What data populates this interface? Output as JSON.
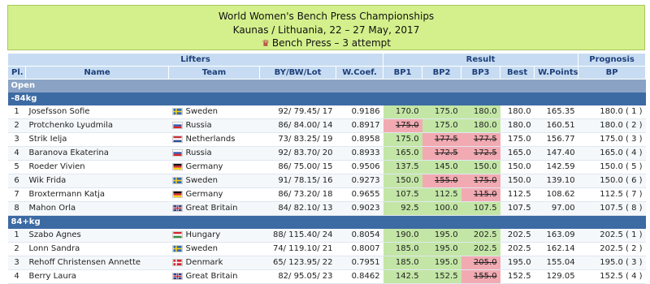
{
  "header": {
    "title": "World Women's Bench Press Championships",
    "location": "Kaunas / Lithuania, 22 – 27 May, 2017",
    "event": "Bench Press – 3 attempt"
  },
  "columns": {
    "group_lifters": "Lifters",
    "group_result": "Result",
    "group_prognosis": "Prognosis",
    "pl": "Pl.",
    "name": "Name",
    "team": "Team",
    "by": "BY/BW/Lot",
    "wcoef": "W.Coef.",
    "bp1": "BP1",
    "bp2": "BP2",
    "bp3": "BP3",
    "best": "Best",
    "wpoints": "W.Points",
    "bp": "BP"
  },
  "category_open": "Open",
  "classes": [
    {
      "label": "-84kg",
      "rows": [
        {
          "pl": "1",
          "name": "Josefsson Sofie",
          "team": "Sweden",
          "flag": "se",
          "by": "92/ 79.45/ 17",
          "wcoef": "0.9186",
          "bp1": "170.0",
          "bp1s": "good",
          "bp2": "175.0",
          "bp2s": "good",
          "bp3": "180.0",
          "bp3s": "good",
          "best": "180.0",
          "wpoints": "165.35",
          "bp": "180.0 ( 1 )"
        },
        {
          "pl": "2",
          "name": "Protchenko Lyudmila",
          "team": "Russia",
          "flag": "ru",
          "by": "86/ 84.00/ 14",
          "wcoef": "0.8917",
          "bp1": "175.0",
          "bp1s": "bad",
          "bp2": "175.0",
          "bp2s": "good",
          "bp3": "180.0",
          "bp3s": "good",
          "best": "180.0",
          "wpoints": "160.51",
          "bp": "180.0 ( 2 )"
        },
        {
          "pl": "3",
          "name": "Strik Ielja",
          "team": "Netherlands",
          "flag": "nl",
          "by": "73/ 83.25/ 19",
          "wcoef": "0.8958",
          "bp1": "175.0",
          "bp1s": "good",
          "bp2": "177.5",
          "bp2s": "bad",
          "bp3": "177.5",
          "bp3s": "bad",
          "best": "175.0",
          "wpoints": "156.77",
          "bp": "175.0 ( 3 )"
        },
        {
          "pl": "4",
          "name": "Baranova Ekaterina",
          "team": "Russia",
          "flag": "ru",
          "by": "92/ 83.70/ 20",
          "wcoef": "0.8933",
          "bp1": "165.0",
          "bp1s": "good",
          "bp2": "172.5",
          "bp2s": "bad",
          "bp3": "172.5",
          "bp3s": "bad",
          "best": "165.0",
          "wpoints": "147.40",
          "bp": "165.0 ( 4 )"
        },
        {
          "pl": "5",
          "name": "Roeder Vivien",
          "team": "Germany",
          "flag": "de",
          "by": "86/ 75.00/ 15",
          "wcoef": "0.9506",
          "bp1": "137.5",
          "bp1s": "good",
          "bp2": "145.0",
          "bp2s": "good",
          "bp3": "150.0",
          "bp3s": "good",
          "best": "150.0",
          "wpoints": "142.59",
          "bp": "150.0 ( 5 )"
        },
        {
          "pl": "6",
          "name": "Wik Frida",
          "team": "Sweden",
          "flag": "se",
          "by": "91/ 78.15/ 16",
          "wcoef": "0.9273",
          "bp1": "150.0",
          "bp1s": "good",
          "bp2": "155.0",
          "bp2s": "bad",
          "bp3": "175.0",
          "bp3s": "bad",
          "best": "150.0",
          "wpoints": "139.10",
          "bp": "150.0 ( 6 )"
        },
        {
          "pl": "7",
          "name": "Broxtermann Katja",
          "team": "Germany",
          "flag": "de",
          "by": "86/ 73.20/ 18",
          "wcoef": "0.9655",
          "bp1": "107.5",
          "bp1s": "good",
          "bp2": "112.5",
          "bp2s": "good",
          "bp3": "115.0",
          "bp3s": "bad",
          "best": "112.5",
          "wpoints": "108.62",
          "bp": "112.5 ( 7 )"
        },
        {
          "pl": "8",
          "name": "Mahon Orla",
          "team": "Great Britain",
          "flag": "gb",
          "by": "84/ 82.10/ 13",
          "wcoef": "0.9023",
          "bp1": "92.5",
          "bp1s": "good",
          "bp2": "100.0",
          "bp2s": "good",
          "bp3": "107.5",
          "bp3s": "good",
          "best": "107.5",
          "wpoints": "97.00",
          "bp": "107.5 ( 8 )"
        }
      ]
    },
    {
      "label": "84+kg",
      "rows": [
        {
          "pl": "1",
          "name": "Szabo Agnes",
          "team": "Hungary",
          "flag": "hu",
          "by": "88/ 115.40/ 24",
          "wcoef": "0.8054",
          "bp1": "190.0",
          "bp1s": "good",
          "bp2": "195.0",
          "bp2s": "good",
          "bp3": "202.5",
          "bp3s": "good",
          "best": "202.5",
          "wpoints": "163.09",
          "bp": "202.5 ( 1 )"
        },
        {
          "pl": "2",
          "name": "Lonn Sandra",
          "team": "Sweden",
          "flag": "se",
          "by": "74/ 119.10/ 21",
          "wcoef": "0.8007",
          "bp1": "185.0",
          "bp1s": "good",
          "bp2": "195.0",
          "bp2s": "good",
          "bp3": "202.5",
          "bp3s": "good",
          "best": "202.5",
          "wpoints": "162.14",
          "bp": "202.5 ( 2 )"
        },
        {
          "pl": "3",
          "name": "Rehoff Christensen Annette",
          "team": "Denmark",
          "flag": "dk",
          "by": "65/ 123.95/ 22",
          "wcoef": "0.7951",
          "bp1": "185.0",
          "bp1s": "good",
          "bp2": "195.0",
          "bp2s": "good",
          "bp3": "205.0",
          "bp3s": "bad",
          "best": "195.0",
          "wpoints": "155.04",
          "bp": "195.0 ( 3 )"
        },
        {
          "pl": "4",
          "name": "Berry Laura",
          "team": "Great Britain",
          "flag": "gb",
          "by": "82/ 95.05/ 23",
          "wcoef": "0.8462",
          "bp1": "142.5",
          "bp1s": "good",
          "bp2": "152.5",
          "bp2s": "good",
          "bp3": "155.0",
          "bp3s": "bad",
          "best": "152.5",
          "wpoints": "129.05",
          "bp": "152.5 ( 4 )"
        }
      ]
    }
  ],
  "flag_colors": {
    "se": [
      "#2f6bb8",
      "#f5cf1f"
    ],
    "ru": [
      "#ffffff",
      "#2f55b0",
      "#d3262c"
    ],
    "nl": [
      "#c7303c",
      "#ffffff",
      "#2c4d9a"
    ],
    "de": [
      "#111111",
      "#d3262c",
      "#f5cf1f"
    ],
    "gb": [
      "#2c3f8a",
      "#ffffff",
      "#d3262c"
    ],
    "hu": [
      "#d3262c",
      "#ffffff",
      "#3c8a3c"
    ],
    "dk": [
      "#d3262c",
      "#ffffff"
    ]
  }
}
